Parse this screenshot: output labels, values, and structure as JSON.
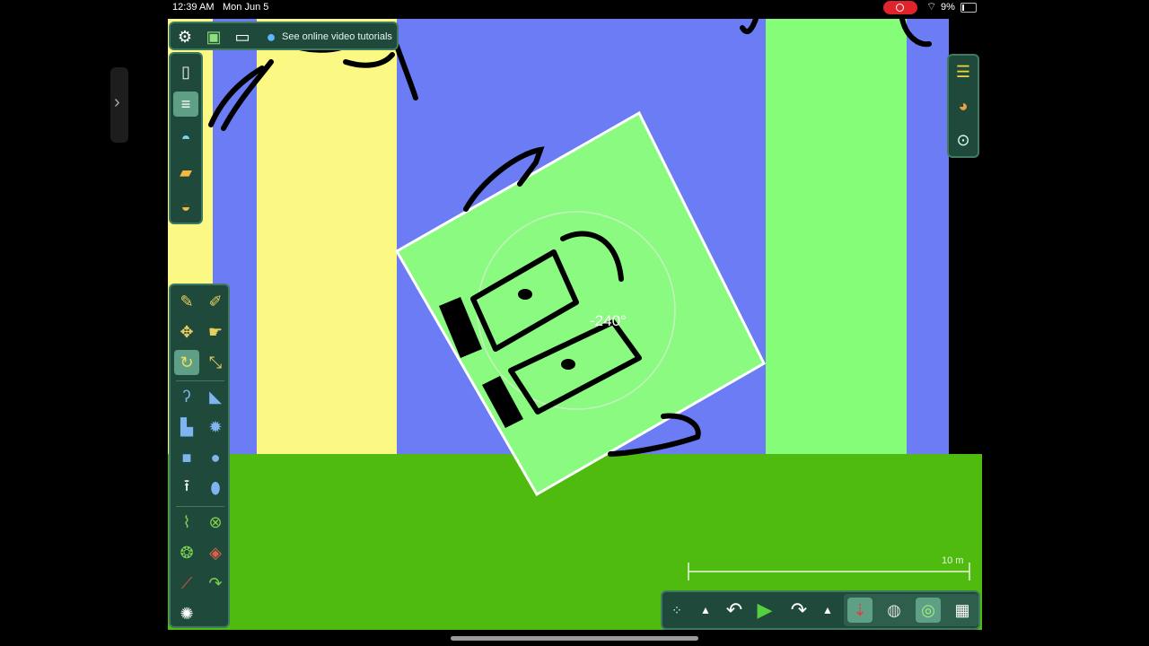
{
  "status_bar": {
    "time": "12:39 AM",
    "date": "Mon Jun 5",
    "battery": "9%"
  },
  "top_toolbar": {
    "tutorial_label": "See online video tutorials"
  },
  "canvas": {
    "rotation_readout": "-240°",
    "scale_label": "10 m",
    "colors": {
      "sky": "#6b7cf5",
      "ground": "#4fbb0e",
      "yellow_column": "#fbf983",
      "green_column": "#85fd78",
      "rotating_box": "#8afb80"
    }
  },
  "icons": {
    "top": [
      "gear-icon",
      "play-scene-icon",
      "window-icon",
      "globe-icon"
    ],
    "file_panel": [
      "new-document-icon",
      "save-icon",
      "scene-icon",
      "folder-icon",
      "open-scene-icon"
    ],
    "right_panel": [
      "layers-icon",
      "palette-icon",
      "zoom-icon"
    ],
    "tools": [
      "sketch-icon",
      "brush-icon",
      "move-icon",
      "drag-icon",
      "rotate-icon",
      "scale-icon",
      "rope-icon",
      "knife-icon",
      "plane-icon",
      "gear-shape-icon",
      "box-icon",
      "circle-icon",
      "fixate-icon",
      "polygon-icon",
      "spring-icon",
      "delete-icon",
      "hinge-icon",
      "tracer-icon",
      "laser-icon",
      "thruster-icon",
      "texture-icon"
    ],
    "sim": [
      "grid-dots-icon",
      "chevron-up-icon",
      "undo-icon",
      "play-icon",
      "redo-icon",
      "chevron-up-icon",
      "gravity-icon",
      "sticker-icon",
      "controller-icon",
      "grid-icon"
    ]
  }
}
